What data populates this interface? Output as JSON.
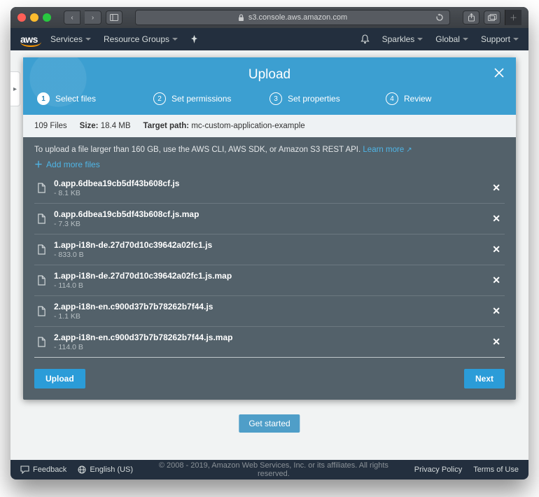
{
  "browser": {
    "address": "s3.console.aws.amazon.com"
  },
  "aws_nav": {
    "logo": "aws",
    "services": "Services",
    "resource_groups": "Resource Groups",
    "account": "Sparkles",
    "region": "Global",
    "support": "Support"
  },
  "sidebar": {
    "collapse_glyph": "▸"
  },
  "background_button": "Get started",
  "footer": {
    "feedback": "Feedback",
    "language": "English (US)",
    "copyright": "© 2008 - 2019, Amazon Web Services, Inc. or its affiliates. All rights reserved.",
    "privacy": "Privacy Policy",
    "terms": "Terms of Use"
  },
  "modal": {
    "title": "Upload",
    "steps": [
      {
        "num": "1",
        "label": "Select files",
        "active": true
      },
      {
        "num": "2",
        "label": "Set permissions",
        "active": false
      },
      {
        "num": "3",
        "label": "Set properties",
        "active": false
      },
      {
        "num": "4",
        "label": "Review",
        "active": false
      }
    ],
    "info": {
      "count_label": "109 Files",
      "size_key": "Size:",
      "size_val": "18.4 MB",
      "target_key": "Target path:",
      "target_val": "mc-custom-application-example"
    },
    "hint_text": "To upload a file larger than 160 GB, use the AWS CLI, AWS SDK, or Amazon S3 REST API.",
    "hint_link": "Learn more",
    "add_more": "Add more files",
    "files": [
      {
        "name": "0.app.6dbea19cb5df43b608cf.js",
        "size": "- 8.1 KB"
      },
      {
        "name": "0.app.6dbea19cb5df43b608cf.js.map",
        "size": "- 7.3 KB"
      },
      {
        "name": "1.app-i18n-de.27d70d10c39642a02fc1.js",
        "size": "- 833.0 B"
      },
      {
        "name": "1.app-i18n-de.27d70d10c39642a02fc1.js.map",
        "size": "- 114.0 B"
      },
      {
        "name": "2.app-i18n-en.c900d37b7b78262b7f44.js",
        "size": "- 1.1 KB"
      },
      {
        "name": "2.app-i18n-en.c900d37b7b78262b7f44.js.map",
        "size": "- 114.0 B"
      }
    ],
    "upload_btn": "Upload",
    "next_btn": "Next"
  }
}
